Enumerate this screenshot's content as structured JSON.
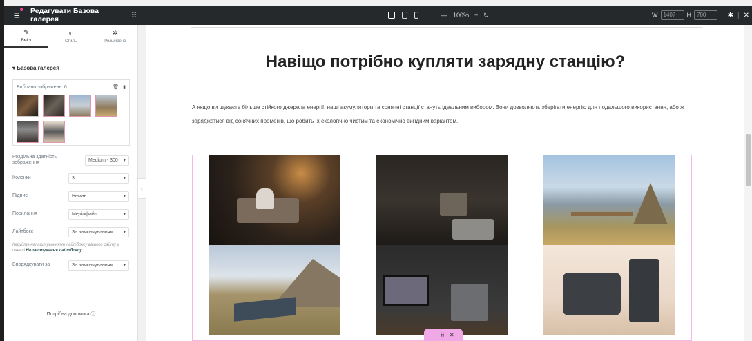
{
  "topbar": {
    "title": "Редагувати Базова галерея",
    "zoom": "100%",
    "width_label": "W",
    "width_value": "1407",
    "height_label": "H",
    "height_value": "780"
  },
  "sidebar": {
    "tabs": [
      {
        "label": "Вміст",
        "icon": "pencil-icon"
      },
      {
        "label": "Стиль",
        "icon": "contrast-icon"
      },
      {
        "label": "Розширене",
        "icon": "gear-icon"
      }
    ],
    "section_title": "▾ Базова галерея",
    "gallery_count": "Вибрано зображень: 6",
    "fields": [
      {
        "label": "Роздільна здатність зображення",
        "value": "Medium - 300"
      },
      {
        "label": "Колонки",
        "value": "3"
      },
      {
        "label": "Підпис",
        "value": "Немає"
      },
      {
        "label": "Посилання",
        "value": "Медіафайл"
      },
      {
        "label": "Лайтбокс",
        "value": "За замовчуванням"
      }
    ],
    "note_prefix": "Керуйте налаштуваннями лайтбоксу вашого сайту у панелі ",
    "note_link": "Налаштування лайтбоксу",
    "order": {
      "label": "Впорядкувати за",
      "value": "За замовчуванням"
    },
    "help": "Потрібна допомога"
  },
  "canvas": {
    "heading": "Навіщо потрібно купляти зарядну станцію?",
    "paragraph": "А якщо ви шукаєте більше стійкого джерела енергії, наші акумулятори та сонячні станції стануть ідеальним вибором. Вони дозволяють зберігати енергію для подальшого використання, або ж заряджатися від сонячних променів, що робить їх екологічно чистим та економічно вигідним варіантом."
  },
  "colors": {
    "accent": "#f4b7e8",
    "topbar": "#26292c"
  }
}
